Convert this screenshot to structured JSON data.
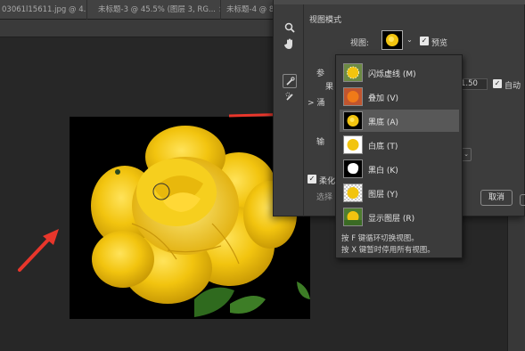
{
  "document_tabs": [
    {
      "label": "03061l15611.jpg @ 4...",
      "close": "×"
    },
    {
      "label": "未标题-3 @ 45.5% (图层 3, RG...",
      "close": "×"
    },
    {
      "label": "未标题-4 @ 8",
      "close": "×"
    }
  ],
  "dialog": {
    "view_mode_title": "视图模式",
    "view_label": "视图:",
    "preview_label": "预览",
    "preview_checked": true,
    "params_label_fragment": "参",
    "row_fragment_1": "果",
    "row_fragment_2": "> 涌",
    "radius_value": "1.50",
    "auto_label": "自动",
    "auto_checked": true,
    "output_label_fragment": "输",
    "output_dropdown_icon": "chevron-down",
    "checkbox_fragment": "柔化",
    "select_fragment": "选择",
    "cancel_button": "取消",
    "colors": {
      "dialog_bg": "#3c3c3c",
      "popup_bg": "#3b3b3b",
      "selected_bg": "#585858",
      "accent_red": "#e8362b",
      "flower": "#f2c40f"
    }
  },
  "view_menu": {
    "items": [
      {
        "label": "闪烁虚线 (M)",
        "thumb": "marching-ants"
      },
      {
        "label": "叠加 (V)",
        "thumb": "overlay-red"
      },
      {
        "label": "黑底 (A)",
        "thumb": "on-black",
        "selected": true
      },
      {
        "label": "白底 (T)",
        "thumb": "on-white"
      },
      {
        "label": "黑白 (K)",
        "thumb": "black-white"
      },
      {
        "label": "图层 (Y)",
        "thumb": "on-layers"
      },
      {
        "label": "显示图层 (R)",
        "thumb": "reveal-layer"
      }
    ],
    "hints": [
      "按 F 键循环切换视图。",
      "按 X 键暂时停用所有视图。"
    ]
  }
}
